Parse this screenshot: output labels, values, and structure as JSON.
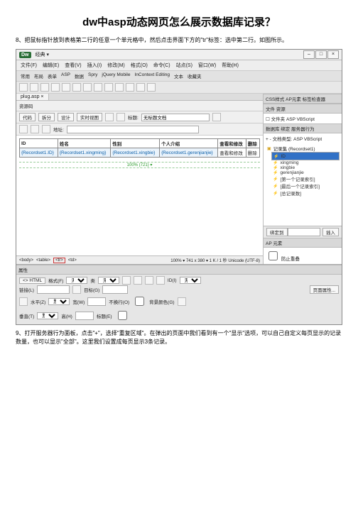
{
  "article": {
    "title": "dw中asp动态网页怎么展示数据库记录？",
    "step8": "8、把鼠标指针放到表格第二行的任意一个单元格中，然后点击界面下方的\"tr\"标签：选中第二行。如图所示。",
    "step9": "9、打开服务器行为面板，点击\"+\"，选择\"重复区域\"。在弹出的页面中我们看到有一个\"显示\"选项，可以自己自定义每页显示的记录数量，也可以显示\"全部\"。这里我们设置成每页显示3条记录。"
  },
  "dw": {
    "logo": "Dw",
    "layout": "经典 ▾",
    "winbtns": [
      "–",
      "□",
      "×"
    ],
    "menus": [
      "文件(F)",
      "编辑(E)",
      "查看(V)",
      "插入(I)",
      "修改(M)",
      "格式(O)",
      "命令(C)",
      "站点(S)",
      "窗口(W)",
      "帮助(H)"
    ],
    "subtabs": [
      "常用",
      "布局",
      "表单",
      "ASP",
      "数据",
      "Spry",
      "jQuery Mobile",
      "InContext Editing",
      "文本",
      "收藏夹"
    ],
    "doc_tab": "plug.asp ×",
    "source_label": "资源码",
    "view_buttons": [
      "代码",
      "拆分",
      "设计",
      "实时视图"
    ],
    "title_label": "标题:",
    "title_value": "无标题文档",
    "address_label": "地址:",
    "table": {
      "headers": [
        "ID",
        "姓名",
        "性别",
        "个人介绍",
        "查看和修改",
        "删除"
      ],
      "cells": [
        "{Recordset1.ID}",
        "{Recordset1.xingming}",
        "{Recordset1.xingbie}",
        "{Recordset1.gerenjianjie}",
        "查看和修改",
        "删除"
      ]
    },
    "ruler": "100% (721) ▾",
    "tagpath": [
      "<body>",
      "<table>",
      "<tr>",
      "<td>"
    ],
    "status_right": "100% ▾   741 x 380 ▾  1 K / 1 秒 Unicode (UTF-8)",
    "panels": {
      "css_tabs": "CSS样式  AP元素  标签检查器",
      "files_tabs": "文件 资源",
      "files_dropdown": "☐ 文件夹  ASP VBScript",
      "db_tabs": "数据库 绑定 服务器行为",
      "db_doc": "+ - 文档类型: ASP VBScript",
      "bindings_root": "记录集 (Recordset1)",
      "bindings": [
        "ID",
        "xingming",
        "xingbie",
        "gerenjianjie",
        "[第一个记录索引]",
        "[最后一个记录索引]",
        "[总记录数]"
      ],
      "selected_binding_btn": "绑定到",
      "insert_btn": "插入",
      "ap_label": "AP 元素",
      "prevent_overlap": "防止重叠"
    },
    "props": {
      "panel_title": "属性",
      "html_tab": "<> HTML",
      "format_label": "格式(F)",
      "format_value": "无",
      "class_label": "类",
      "class_value": "无",
      "link_label": "链接(L)",
      "id_label": "ID(I)",
      "id_value": "无",
      "target_label": "目标(G)",
      "horiz_label": "水平(Z)",
      "horiz_value": "默认",
      "width_label": "宽(W)",
      "nowrap_label": "不换行(O)",
      "bg_label": "背景颜色(G)",
      "vert_label": "垂直(T)",
      "vert_value": "默认",
      "height_label": "高(H)",
      "header_label": "标题(E)",
      "page_props_btn": "页面属性..."
    }
  }
}
